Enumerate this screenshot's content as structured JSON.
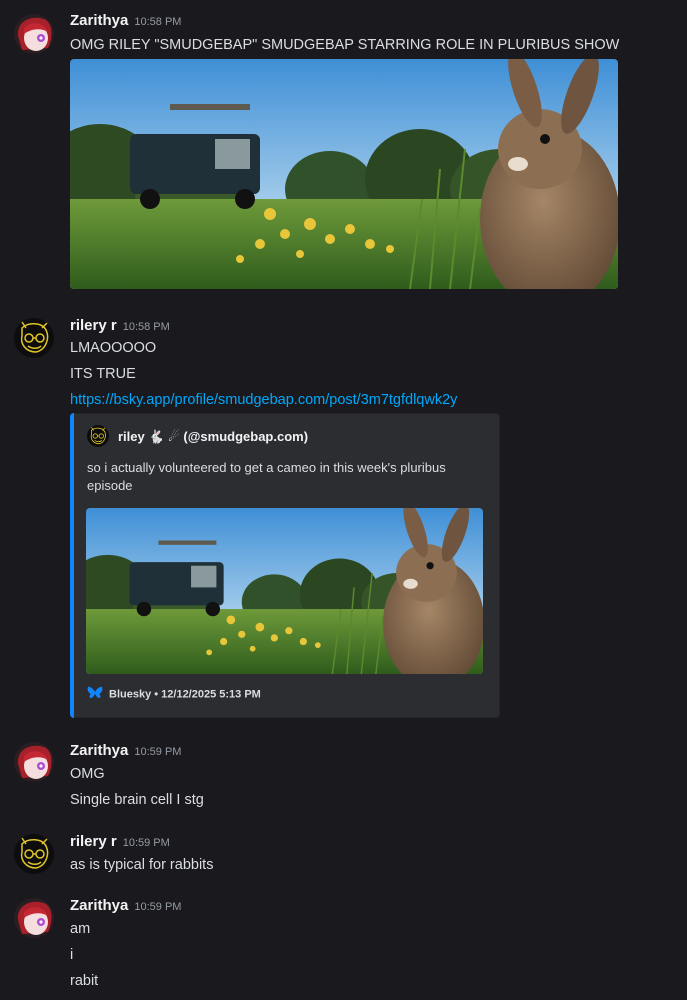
{
  "messages": [
    {
      "author": "Zarithya",
      "time": "10:58 PM",
      "lines": [
        "OMG RILEY \"SMUDGEBAP\" SMUDGEBAP STARRING ROLE IN PLURIBUS SHOW"
      ],
      "has_image": true
    },
    {
      "author": "rilery r",
      "time": "10:58 PM",
      "lines": [
        "LMAOOOOO",
        "ITS TRUE"
      ],
      "link": "https://bsky.app/profile/smudgebap.com/post/3m7tgfdlqwk2y",
      "embed": {
        "author": "riley 🐇 ☄ (@smudgebap.com)",
        "description": "so i actually volunteered to get a cameo in this week's pluribus episode",
        "footer": "Bluesky • 12/12/2025 5:13 PM",
        "accent_color": "#1185fe"
      }
    },
    {
      "author": "Zarithya",
      "time": "10:59 PM",
      "lines": [
        "OMG",
        "Single brain cell I stg"
      ]
    },
    {
      "author": "rilery r",
      "time": "10:59 PM",
      "lines": [
        "as is typical for rabbits"
      ]
    },
    {
      "author": "Zarithya",
      "time": "10:59 PM",
      "lines": [
        "am",
        "i",
        "rabit"
      ]
    }
  ],
  "colors": {
    "background": "#1a1a1e",
    "link": "#00a8fc",
    "embed_bg": "#2b2d31",
    "timestamp": "#949ba4"
  },
  "icons": [
    "zarithya-avatar",
    "rilery-avatar",
    "bluesky-butterfly-icon"
  ]
}
